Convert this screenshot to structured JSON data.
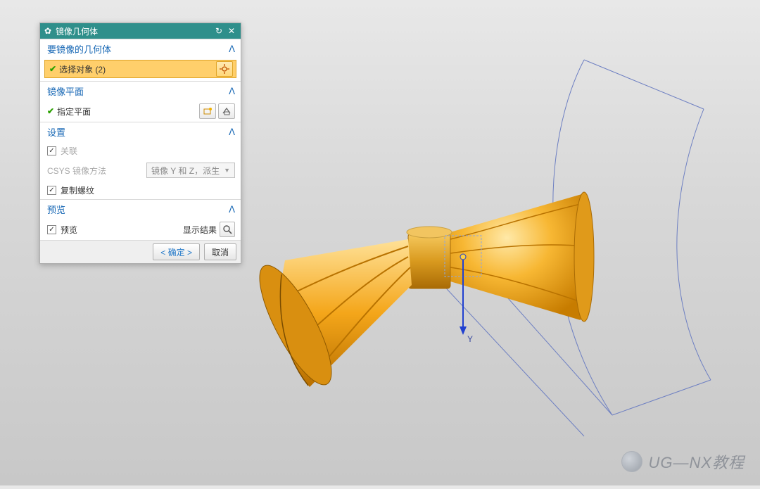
{
  "panel": {
    "title": "镜像几何体",
    "sections": {
      "geom": {
        "header": "要镜像的几何体",
        "select_label": "选择对象 (2)"
      },
      "plane": {
        "header": "镜像平面",
        "specify_label": "指定平面"
      },
      "settings": {
        "header": "设置",
        "assoc_label": "关联",
        "csys_label": "CSYS 镜像方法",
        "csys_value": "镜像 Y 和 Z，派生",
        "copy_thread_label": "复制螺纹"
      },
      "preview": {
        "header": "预览",
        "preview_label": "预览",
        "show_result_label": "显示结果"
      }
    },
    "buttons": {
      "ok": "< 确定 >",
      "cancel": "取消"
    }
  },
  "axis_label": "Y",
  "watermark": "UG—NX教程"
}
